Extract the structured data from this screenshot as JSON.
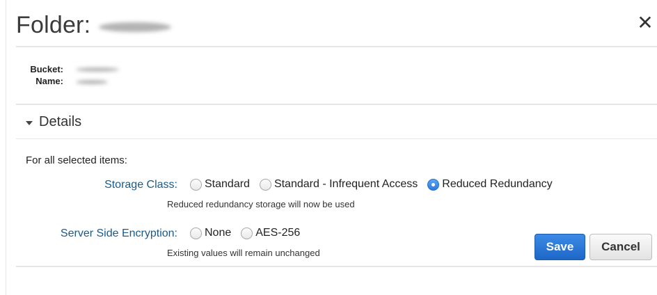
{
  "dialog": {
    "title": "Folder:",
    "close_glyph": "✕"
  },
  "bucket": {
    "bucket_label": "Bucket:",
    "name_label": "Name:"
  },
  "details": {
    "toggle_label": "Details",
    "for_all_label": "For all selected items:"
  },
  "storage_class": {
    "label": "Storage Class:",
    "options": [
      {
        "label": "Standard",
        "checked": false
      },
      {
        "label": "Standard - Infrequent Access",
        "checked": false
      },
      {
        "label": "Reduced Redundancy",
        "checked": true
      }
    ],
    "hint": "Reduced redundancy storage will now be used"
  },
  "encryption": {
    "label": "Server Side Encryption:",
    "options": [
      {
        "label": "None",
        "checked": false
      },
      {
        "label": "AES-256",
        "checked": false
      }
    ],
    "hint": "Existing values will remain unchanged"
  },
  "buttons": {
    "save": "Save",
    "cancel": "Cancel"
  },
  "colors": {
    "accent": "#2c7be0",
    "label_blue": "#1a5a8a"
  }
}
